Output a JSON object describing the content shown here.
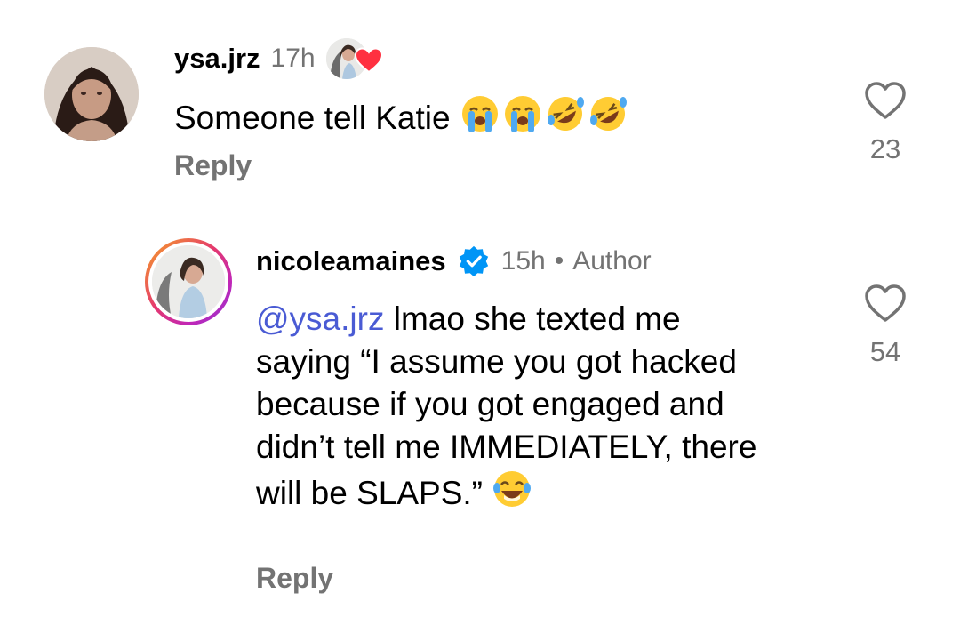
{
  "comments": [
    {
      "username": "ysa.jrz",
      "time": "17h",
      "liked_by_author": true,
      "text": "Someone tell Katie",
      "emojis": [
        "loudly-crying-face",
        "loudly-crying-face",
        "rolling-on-floor-laughing",
        "rolling-on-floor-laughing"
      ],
      "reply_label": "Reply",
      "like_count": "23",
      "icons": {
        "like": "heart-outline-icon",
        "liked_by": "red-heart-icon"
      }
    },
    {
      "username": "nicoleamaines",
      "verified": true,
      "time": "15h",
      "separator": "•",
      "badge": "Author",
      "mention": "@ysa.jrz",
      "text": " lmao she texted me saying “I assume you got hacked because if you got engaged and didn’t tell me IMMEDIATELY, there will be SLAPS.”",
      "emojis": [
        "face-with-tears-of-joy"
      ],
      "reply_label": "Reply",
      "like_count": "54",
      "icons": {
        "like": "heart-outline-icon",
        "verified": "verified-badge-icon"
      }
    }
  ],
  "colors": {
    "secondary_text": "#737373",
    "mention": "#4a5bd4",
    "verified": "#0095f6",
    "liked_heart": "#ff3040"
  }
}
